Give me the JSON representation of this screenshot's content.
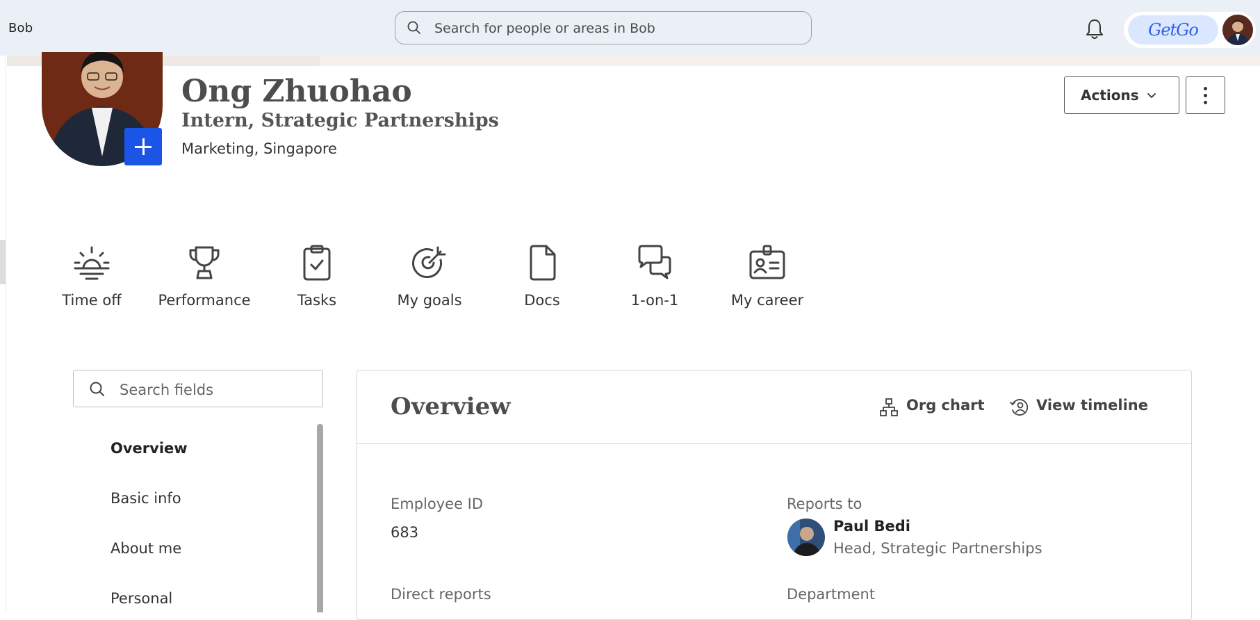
{
  "topbar": {
    "logo": "Bob",
    "search_placeholder": "Search for people or areas in Bob",
    "brand_logo_text": "GetGo"
  },
  "profile": {
    "name": "Ong Zhuohao",
    "title": "Intern, Strategic Partnerships",
    "location": "Marketing, Singapore",
    "actions_label": "Actions"
  },
  "shortcuts": [
    {
      "label": "Time off",
      "icon": "sunrise-icon"
    },
    {
      "label": "Performance",
      "icon": "trophy-icon"
    },
    {
      "label": "Tasks",
      "icon": "clipboard-check-icon"
    },
    {
      "label": "My goals",
      "icon": "target-icon"
    },
    {
      "label": "Docs",
      "icon": "document-icon"
    },
    {
      "label": "1-on-1",
      "icon": "chat-bubbles-icon"
    },
    {
      "label": "My career",
      "icon": "id-badge-icon"
    }
  ],
  "sidenav": {
    "search_placeholder": "Search fields",
    "items": [
      {
        "label": "Overview",
        "active": true
      },
      {
        "label": "Basic info"
      },
      {
        "label": "About me"
      },
      {
        "label": "Personal"
      }
    ]
  },
  "overview": {
    "title": "Overview",
    "org_chart_label": "Org chart",
    "timeline_label": "View timeline",
    "employee_id_label": "Employee ID",
    "employee_id": "683",
    "reports_to_label": "Reports to",
    "manager_name": "Paul Bedi",
    "manager_title": "Head, Strategic Partnerships",
    "direct_reports_label": "Direct reports",
    "department_label": "Department"
  },
  "colors": {
    "topbar_bg": "#ebf0f6",
    "accent_blue": "#1b55e8",
    "text_dark": "#333333"
  }
}
